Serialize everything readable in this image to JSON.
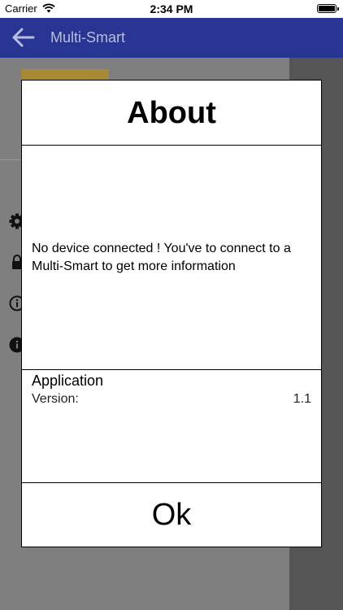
{
  "status_bar": {
    "carrier": "Carrier",
    "time": "2:34 PM"
  },
  "nav_bar": {
    "title": "Multi-Smart",
    "back_icon": "arrow-left-icon",
    "color": "#283593"
  },
  "background_icons": [
    "gear-icon",
    "lock-icon",
    "info-outline-icon",
    "info-filled-icon"
  ],
  "dialog": {
    "title": "About",
    "message": "No device connected ! You've to connect to a Multi-Smart to get more information",
    "section": {
      "heading": "Application",
      "version_label": "Version:",
      "version_value": "1.1"
    },
    "ok_label": "Ok"
  }
}
